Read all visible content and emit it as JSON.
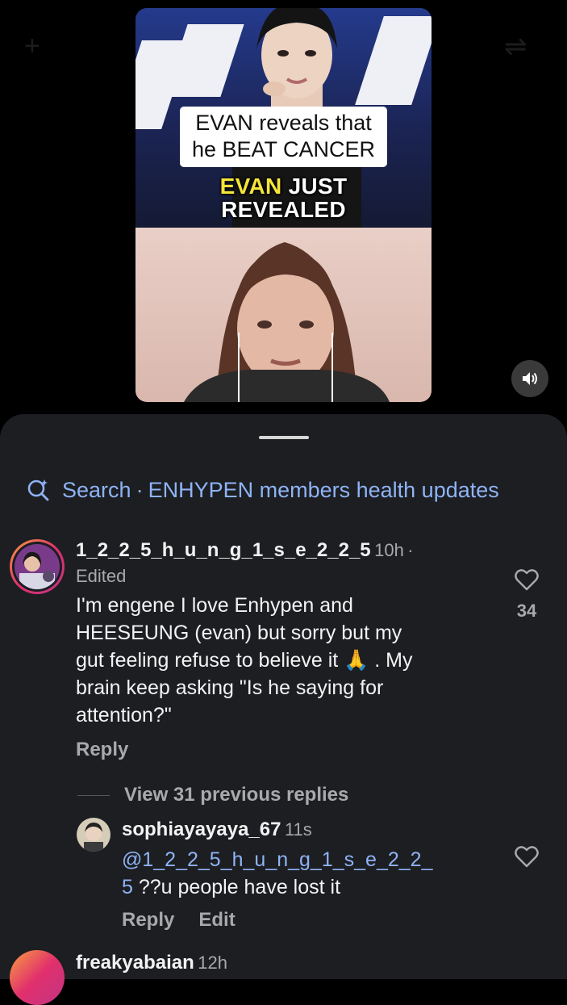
{
  "video": {
    "caption": [
      "EVAN reveals that",
      "he BEAT CANCER"
    ],
    "headline_highlight": "EVAN",
    "headline_rest_line1": "JUST",
    "headline_line2": "REVEALED",
    "sound_icon": "speaker-icon"
  },
  "search": {
    "icon": "search-sparkle-icon",
    "label": "Search",
    "separator": "·",
    "query": "ENHYPEN members health updates"
  },
  "comments": [
    {
      "username": "1_2_2_5_h_u_n_g_1_s_e_2_2_5",
      "time": "10h",
      "separator": "·",
      "edited": "Edited",
      "text_lines": [
        "I'm engene I love Enhypen and",
        "HEESEUNG (evan) but sorry but my",
        "gut feeling refuse to believe it",
        ". My",
        "brain keep asking \"Is he saying for",
        "attention?\""
      ],
      "emoji": "🙏",
      "likes": "34",
      "reply_label": "Reply",
      "view_replies": "View 31 previous replies"
    },
    {
      "username": "sophiayayaya_67",
      "time": "11s",
      "mention_line1": "@1_2_2_5_h_u_n_g_1_s_e_2_2_",
      "mention_line2_start": "5",
      "text_rest": " ??u people have lost it",
      "reply_label": "Reply",
      "edit_label": "Edit"
    },
    {
      "username": "freakyabaian",
      "time": "12h"
    }
  ],
  "colors": {
    "sheet_bg": "#1c1e22",
    "accent_link": "#8fb3f5",
    "headline_highlight": "#f4e53a",
    "muted_text": "#a7a9ad"
  }
}
